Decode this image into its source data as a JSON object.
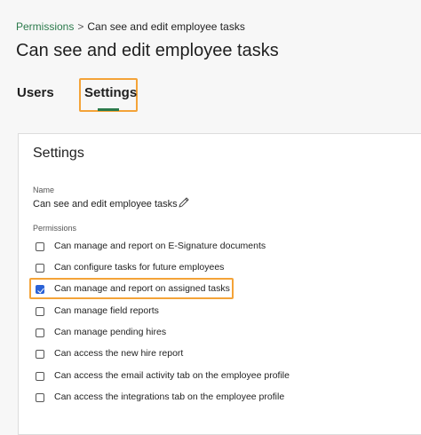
{
  "breadcrumb": {
    "parent": "Permissions",
    "separator": ">",
    "current": "Can see and edit employee tasks"
  },
  "page_title": "Can see and edit employee tasks",
  "tabs": [
    {
      "label": "Users",
      "active": false
    },
    {
      "label": "Settings",
      "active": true
    }
  ],
  "colors": {
    "accent_green": "#2b7a4b",
    "highlight_orange": "#f4a338",
    "checkbox_blue": "#2a62d6"
  },
  "settings": {
    "title": "Settings",
    "name_label": "Name",
    "name_value": "Can see and edit employee tasks",
    "edit_icon": "pencil-icon",
    "permissions_label": "Permissions",
    "permissions": [
      {
        "label": "Can manage and report on E-Signature documents",
        "checked": false
      },
      {
        "label": "Can configure tasks for future employees",
        "checked": false
      },
      {
        "label": "Can manage and report on assigned tasks",
        "checked": true
      },
      {
        "label": "Can manage field reports",
        "checked": false
      },
      {
        "label": "Can manage pending hires",
        "checked": false
      },
      {
        "label": "Can access the new hire report",
        "checked": false
      },
      {
        "label": "Can access the email activity tab on the employee profile",
        "checked": false
      },
      {
        "label": "Can access the integrations tab on the employee profile",
        "checked": false
      }
    ]
  }
}
